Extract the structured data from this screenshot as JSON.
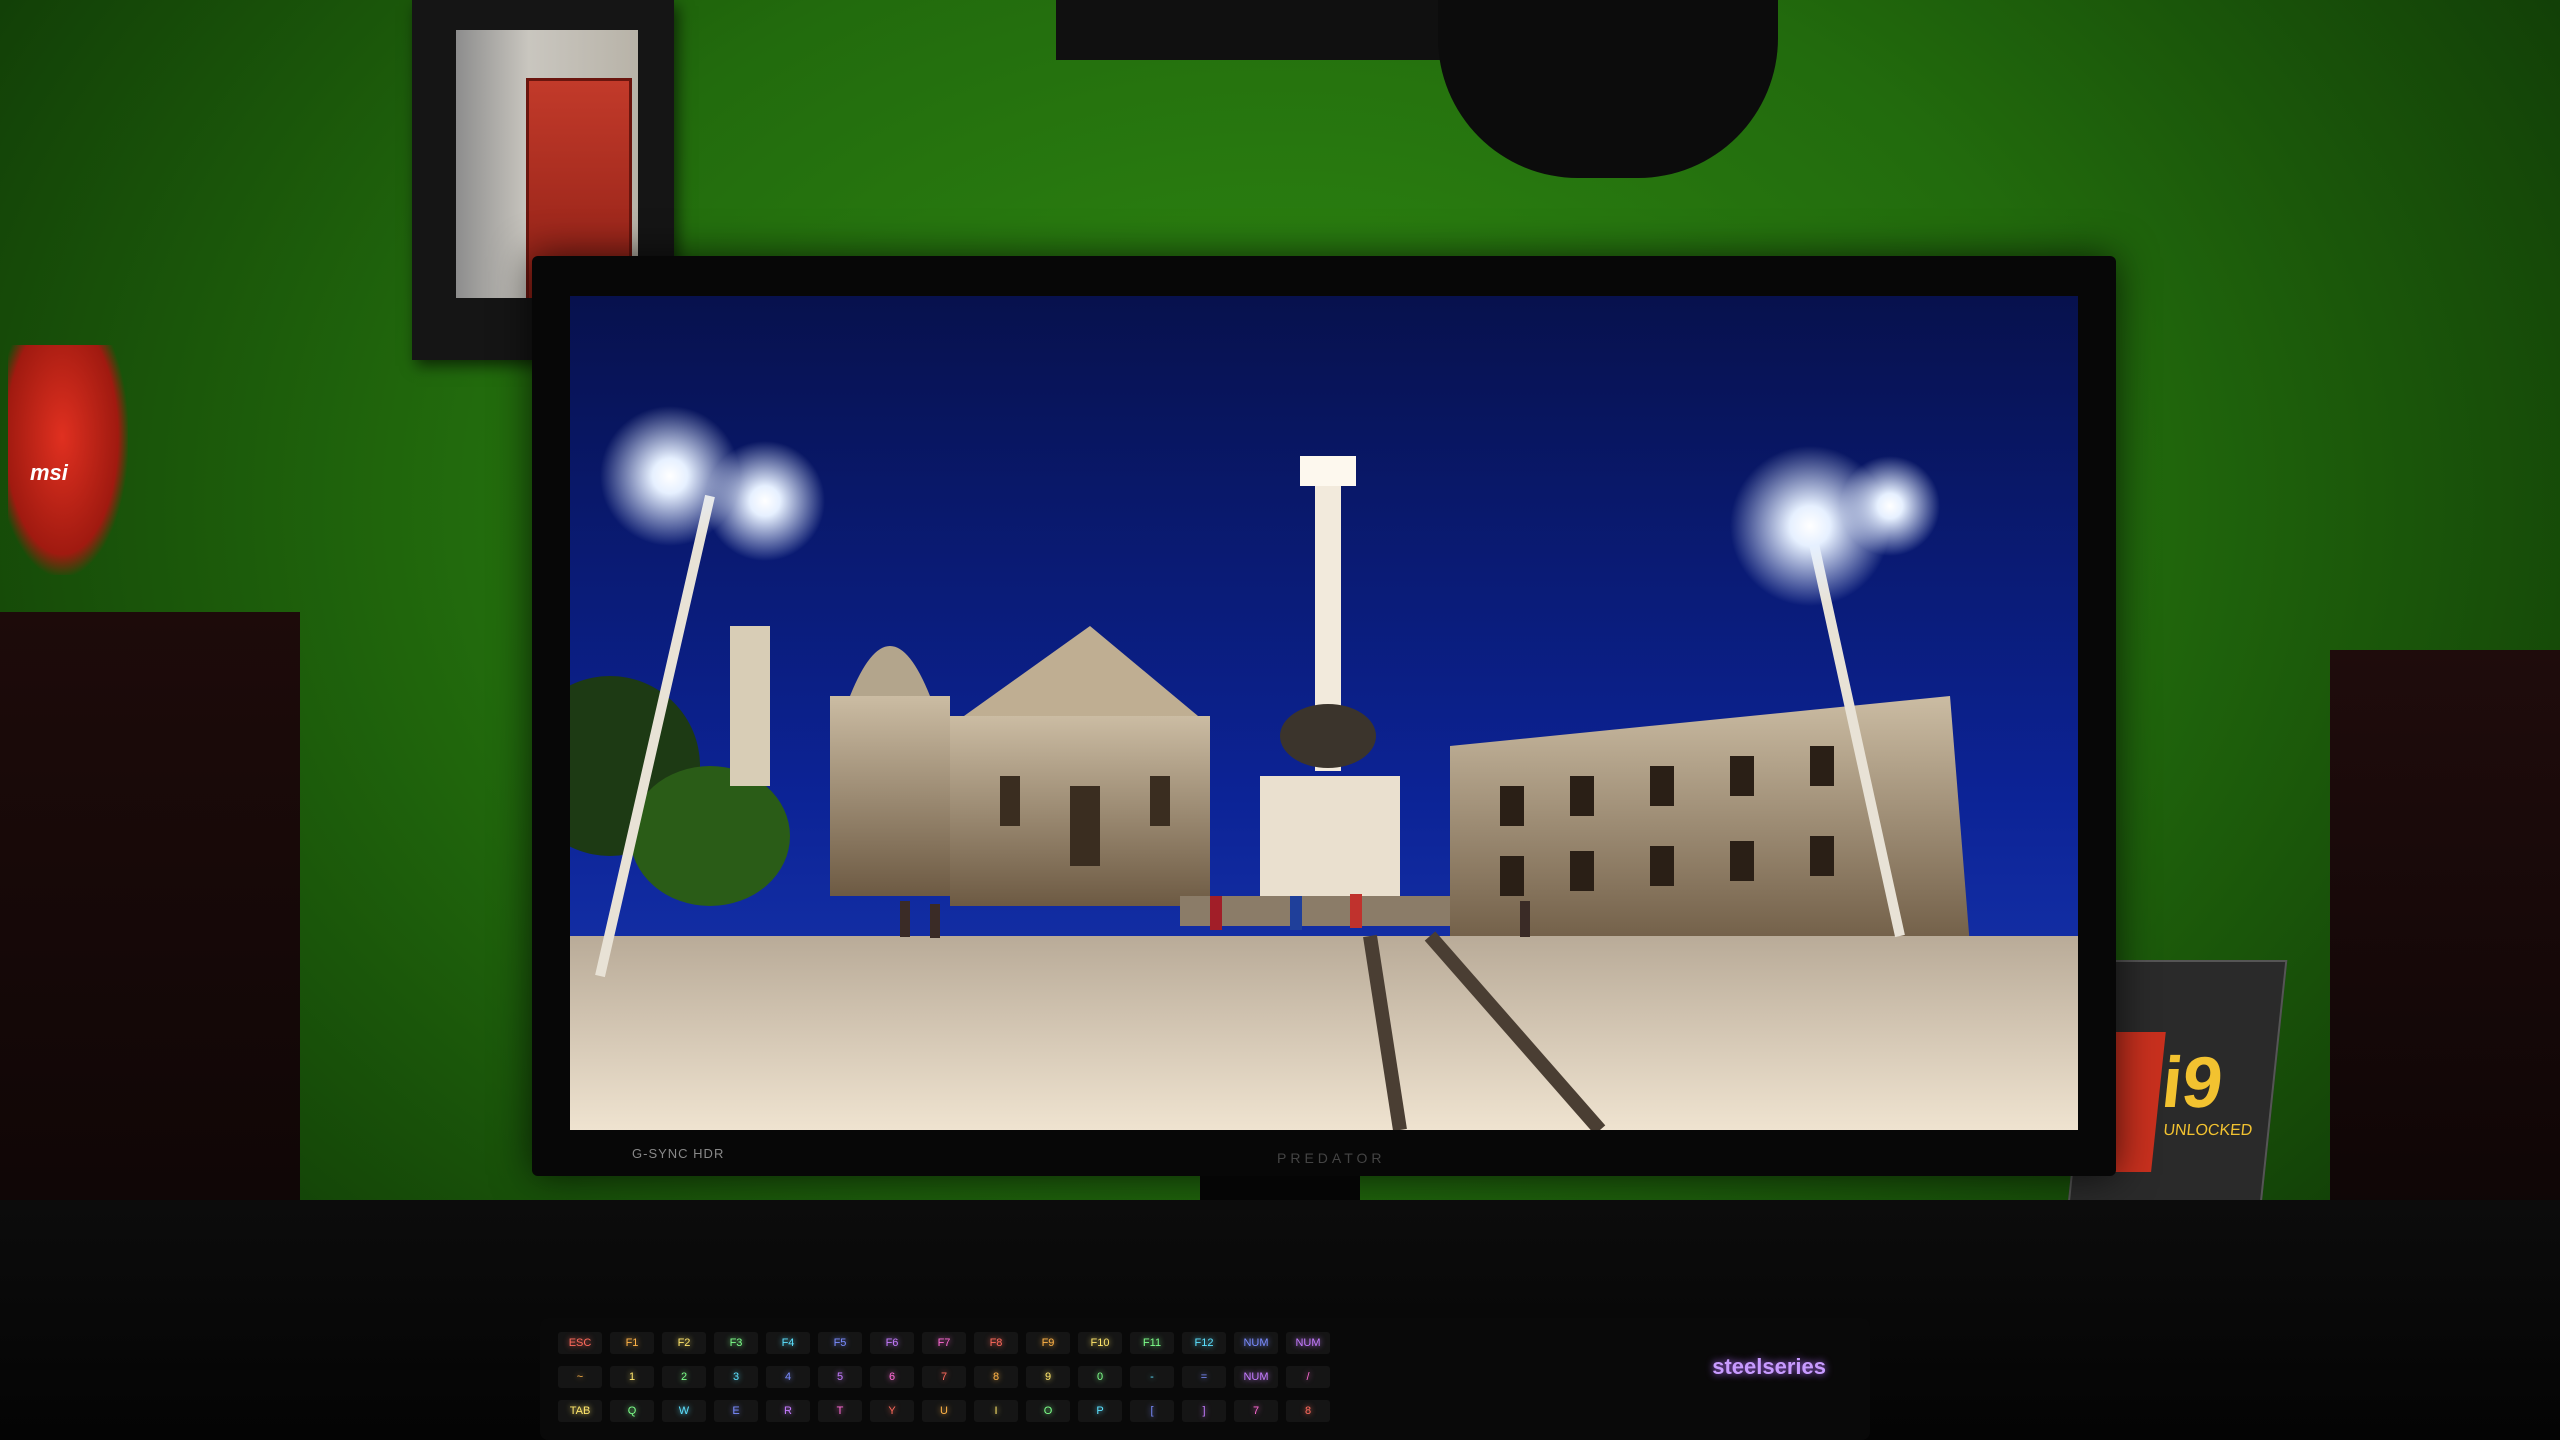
{
  "monitor": {
    "bezel_label": "G-SYNC HDR",
    "brand_label": "PREDATOR"
  },
  "keyboard": {
    "brand": "steelseries",
    "keys_row1": [
      "ESC",
      "F1",
      "F2",
      "F3",
      "F4",
      "F5",
      "F6",
      "F7",
      "F8",
      "F9",
      "F10",
      "F11",
      "F12",
      "NUM",
      "NUM"
    ],
    "keys_row2": [
      "~",
      "1",
      "2",
      "3",
      "4",
      "5",
      "6",
      "7",
      "8",
      "9",
      "0",
      "-",
      "=",
      "NUM",
      "/"
    ],
    "keys_row3": [
      "TAB",
      "Q",
      "W",
      "E",
      "R",
      "T",
      "Y",
      "U",
      "I",
      "O",
      "P",
      "[",
      "]",
      "7",
      "8"
    ]
  },
  "cpu_box": {
    "model": "i9",
    "tag": "UNLOCKED"
  },
  "dragon_figure": {
    "label": "msi"
  },
  "colors": {
    "wall": "#2f8a12",
    "sky": "#0b1d7a",
    "keyboard_glow": "#c57bff"
  }
}
